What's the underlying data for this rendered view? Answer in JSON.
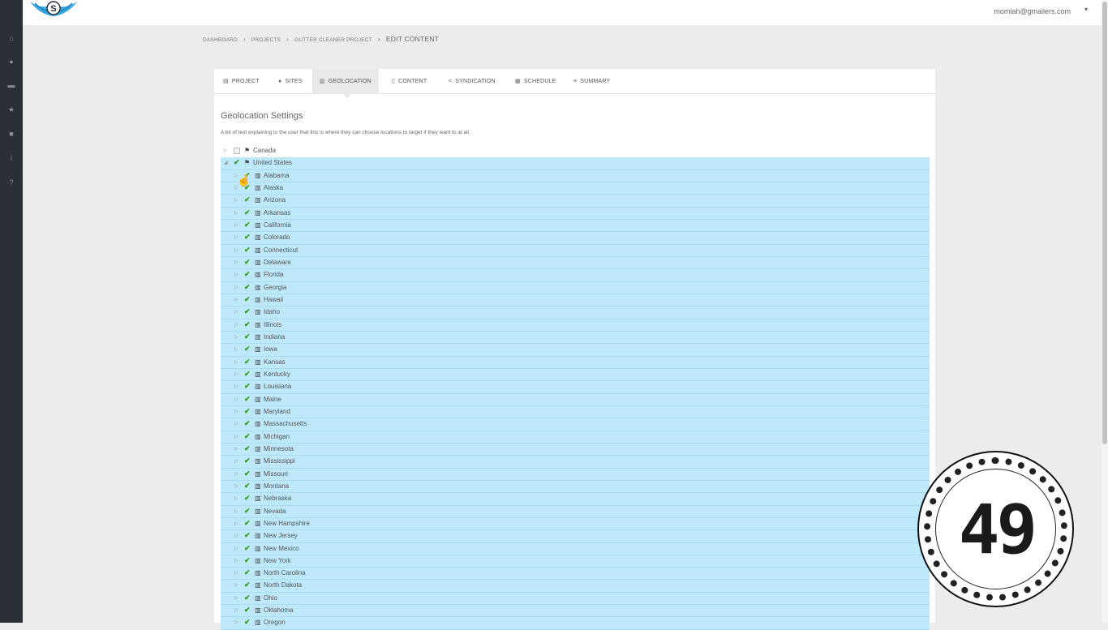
{
  "header": {
    "user_email": "momiah@gmailers.com",
    "user_caret": "▾",
    "logo_letter": "S"
  },
  "sidebar": {
    "icons": [
      "home-icon",
      "globe-icon",
      "briefcase-icon",
      "star-icon",
      "lock-icon",
      "info-icon",
      "question-icon"
    ],
    "glyphs": [
      "⌂",
      "●",
      "▬",
      "★",
      "■",
      "i",
      "?"
    ]
  },
  "breadcrumb": {
    "items": [
      "DASHBOARD",
      "PROJECTS",
      "GUTTER CLEANER PROJECT"
    ],
    "current": "EDIT CONTENT",
    "separator": "›"
  },
  "tabs": [
    {
      "label": "PROJECT",
      "icon": "document-icon",
      "glyph": "▤",
      "active": false
    },
    {
      "label": "SITES",
      "icon": "globe-icon",
      "glyph": "●",
      "active": false
    },
    {
      "label": "GEOLOCATION",
      "icon": "map-icon",
      "glyph": "▥",
      "active": true
    },
    {
      "label": "CONTENT",
      "icon": "file-icon",
      "glyph": "▯",
      "active": false
    },
    {
      "label": "SYNDICATION",
      "icon": "share-icon",
      "glyph": "<",
      "active": false
    },
    {
      "label": "SCHEDULE",
      "icon": "calendar-icon",
      "glyph": "▦",
      "active": false
    },
    {
      "label": "SUMMARY",
      "icon": "list-icon",
      "glyph": "≡",
      "active": false
    }
  ],
  "geolocation": {
    "title": "Geolocation Settings",
    "description": "A bit of text explaining to the user that this is where they can choose locations to target if they want to at all.",
    "countries": [
      {
        "name": "Canada",
        "expanded": false,
        "checked": false
      },
      {
        "name": "United States",
        "expanded": true,
        "checked": true
      }
    ],
    "states": [
      "Alabama",
      "Alaska",
      "Arizona",
      "Arkansas",
      "California",
      "Colorado",
      "Connecticut",
      "Delaware",
      "Florida",
      "Georgia",
      "Hawaii",
      "Idaho",
      "Illinois",
      "Indiana",
      "Iowa",
      "Kansas",
      "Kentucky",
      "Louisiana",
      "Maine",
      "Maryland",
      "Massachusetts",
      "Michigan",
      "Minnesota",
      "Mississippi",
      "Missouri",
      "Montana",
      "Nebraska",
      "Nevada",
      "New Hampshire",
      "New Jersey",
      "New Mexico",
      "New York",
      "North Carolina",
      "North Dakota",
      "Ohio",
      "Oklahoma",
      "Oregon"
    ],
    "states_checked": true
  },
  "timer": {
    "value": "49"
  },
  "colors": {
    "selection": "#bde9fb",
    "check": "#2e9a1c",
    "sidebar": "#2b2f36"
  }
}
